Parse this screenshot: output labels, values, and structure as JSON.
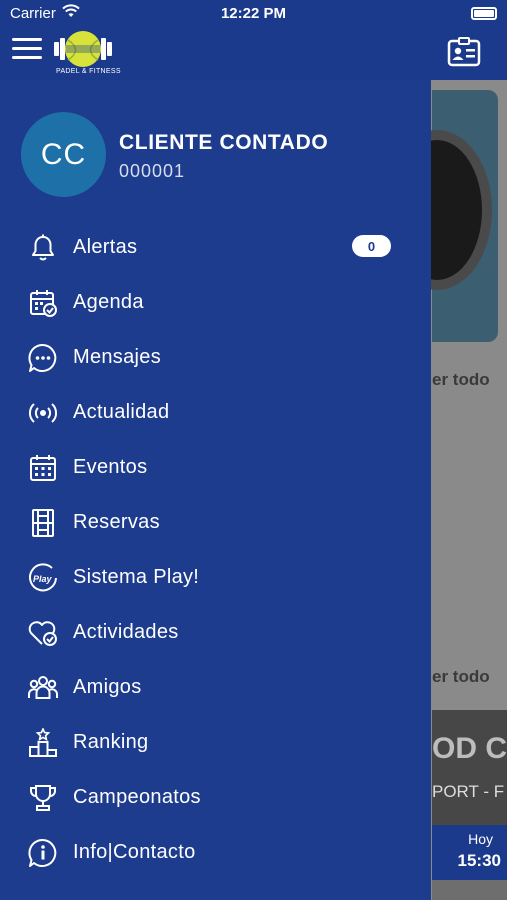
{
  "status_bar": {
    "carrier": "Carrier",
    "time": "12:22 PM"
  },
  "header": {
    "logo_text": "PADEL & FITNESS"
  },
  "user": {
    "initials": "CC",
    "name": "CLIENTE CONTADO",
    "id": "000001"
  },
  "menu": {
    "items": [
      {
        "label": "Alertas",
        "icon": "bell-icon",
        "badge": "0"
      },
      {
        "label": "Agenda",
        "icon": "calendar-check-icon"
      },
      {
        "label": "Mensajes",
        "icon": "chat-bubble-icon"
      },
      {
        "label": "Actualidad",
        "icon": "broadcast-icon"
      },
      {
        "label": "Eventos",
        "icon": "calendar-grid-icon"
      },
      {
        "label": "Reservas",
        "icon": "court-icon"
      },
      {
        "label": "Sistema Play!",
        "icon": "play-badge-icon"
      },
      {
        "label": "Actividades",
        "icon": "heart-check-icon"
      },
      {
        "label": "Amigos",
        "icon": "group-icon"
      },
      {
        "label": "Ranking",
        "icon": "podium-icon"
      },
      {
        "label": "Campeonatos",
        "icon": "trophy-icon"
      },
      {
        "label": "Info|Contacto",
        "icon": "info-chat-icon"
      }
    ]
  },
  "background": {
    "ver_todo_1": "er todo",
    "ver_todo_2": "er todo",
    "banner_big": "OD CI",
    "banner_small": "PORT - F",
    "today_label": "Hoy",
    "today_time": "15:30"
  },
  "colors": {
    "primary": "#1e3c8e",
    "avatar": "#1e71a8",
    "logo_ball": "#d7e33a"
  }
}
